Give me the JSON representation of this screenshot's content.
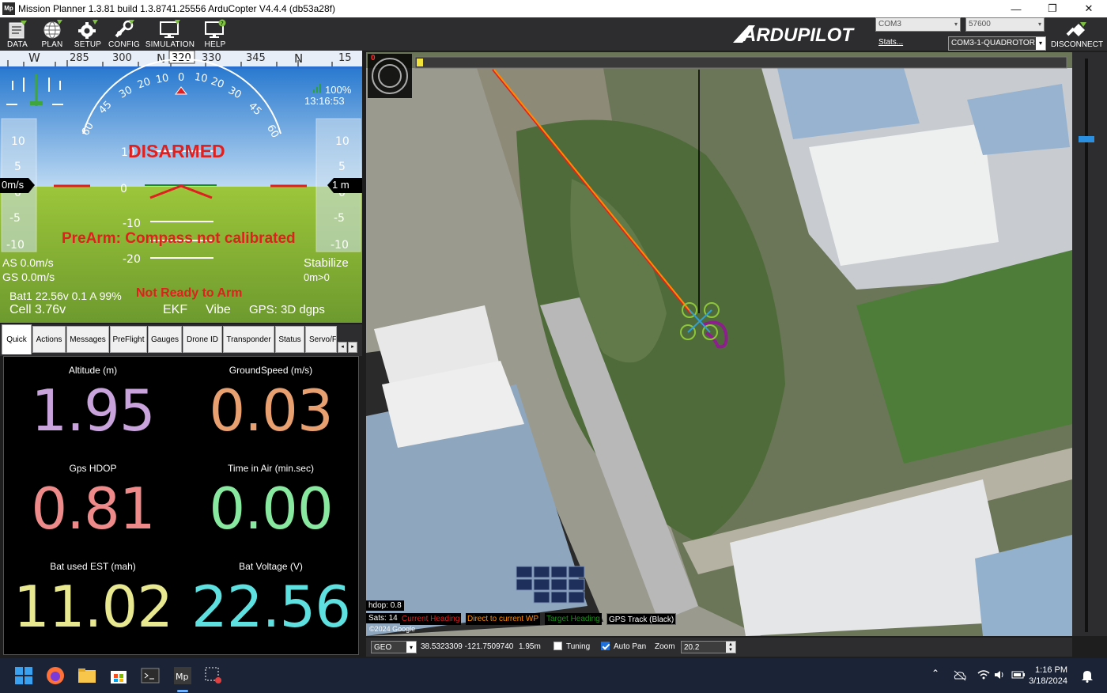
{
  "window": {
    "title": "Mission Planner 1.3.81 build 1.3.8741.25556 ArduCopter V4.4.4 (db53a28f)",
    "app_icon": "Mp",
    "minimize": "—",
    "maximize": "❐",
    "close": "✕"
  },
  "toolbar": {
    "items": [
      {
        "label": "DATA",
        "icon": "data-icon"
      },
      {
        "label": "PLAN",
        "icon": "plan-globe-icon"
      },
      {
        "label": "SETUP",
        "icon": "setup-gear-icon"
      },
      {
        "label": "CONFIG",
        "icon": "config-wrench-icon"
      },
      {
        "label": "SIMULATION",
        "icon": "simulation-monitor-icon"
      },
      {
        "label": "HELP",
        "icon": "help-monitor-icon"
      }
    ],
    "logo_text": "ARDUPILOT",
    "port": "COM3",
    "baud": "57600",
    "link": "COM3-1-QUADROTOR",
    "stats": "Stats...",
    "disconnect": "DISCONNECT"
  },
  "hud": {
    "heading_ticks": [
      "W",
      "285",
      "300",
      "N",
      "320",
      "330",
      "345",
      "N",
      "15"
    ],
    "roll_labels": [
      "60",
      "45",
      "30",
      "20",
      "10",
      "0",
      "10",
      "20",
      "30",
      "45",
      "60"
    ],
    "pitch_labels": [
      "10",
      "0",
      "-10",
      "-20"
    ],
    "speed_ticks": [
      "10",
      "5",
      "0",
      "-5",
      "-10"
    ],
    "alt_ticks": [
      "10",
      "5",
      "0",
      "-5",
      "-10"
    ],
    "speed_box": "0m/s",
    "alt_box": "1 m",
    "link_quality": "100%",
    "time": "13:16:53",
    "status": "DISARMED",
    "prearm": "PreArm: Compass not calibrated",
    "airspeed": "AS 0.0m/s",
    "groundspeed": "GS 0.0m/s",
    "mode": "Stabilize",
    "wp_dist": "0m>0",
    "battery": "Bat1 22.56v 0.1 A 99%",
    "ready": "Not Ready to Arm",
    "cell": "Cell 3.76v",
    "ekf": "EKF",
    "vibe": "Vibe",
    "gps": "GPS: 3D dgps",
    "colors": {
      "sky": "#2f86d6",
      "ground": "#7aa834",
      "warning": "#e0201e"
    }
  },
  "tabs": [
    "Quick",
    "Actions",
    "Messages",
    "PreFlight",
    "Gauges",
    "Drone ID",
    "Transponder",
    "Status",
    "Servo/F"
  ],
  "tab_scroll": {
    "left": "◂",
    "right": "▸"
  },
  "quick": [
    {
      "label": "Altitude (m)",
      "value": "1.95",
      "color": "#c9a3dc"
    },
    {
      "label": "GroundSpeed (m/s)",
      "value": "0.03",
      "color": "#e8a070"
    },
    {
      "label": "Gps HDOP",
      "value": "0.81",
      "color": "#ee8a8a"
    },
    {
      "label": "Time in Air (min.sec)",
      "value": "0.00",
      "color": "#88e8a0"
    },
    {
      "label": "Bat used EST (mah)",
      "value": "11.02",
      "color": "#e8e890"
    },
    {
      "label": "Bat Voltage (V)",
      "value": "22.56",
      "color": "#5ee0e0"
    }
  ],
  "map": {
    "top_left_value": "0",
    "hdop": "hdop: 0.8",
    "sats": "Sats: 14",
    "copyright": "©2024 Google",
    "legend": [
      {
        "label": "Current Heading",
        "color": "#e02020"
      },
      {
        "label": "Direct to current WP",
        "color": "#ff8c00"
      },
      {
        "label": "Target Heading",
        "color": "#1e8e1e"
      },
      {
        "label": "GPS Track (Black)",
        "color": "#ffffff"
      }
    ]
  },
  "mapbar": {
    "coord_type": "GEO",
    "coords": "38.5323309 -121.7509740",
    "alt": "1.95m",
    "tuning": "Tuning",
    "autopan": "Auto Pan",
    "zoom_label": "Zoom",
    "zoom_value": "20.2"
  },
  "taskbar": {
    "time": "1:16 PM",
    "date": "3/18/2024"
  }
}
